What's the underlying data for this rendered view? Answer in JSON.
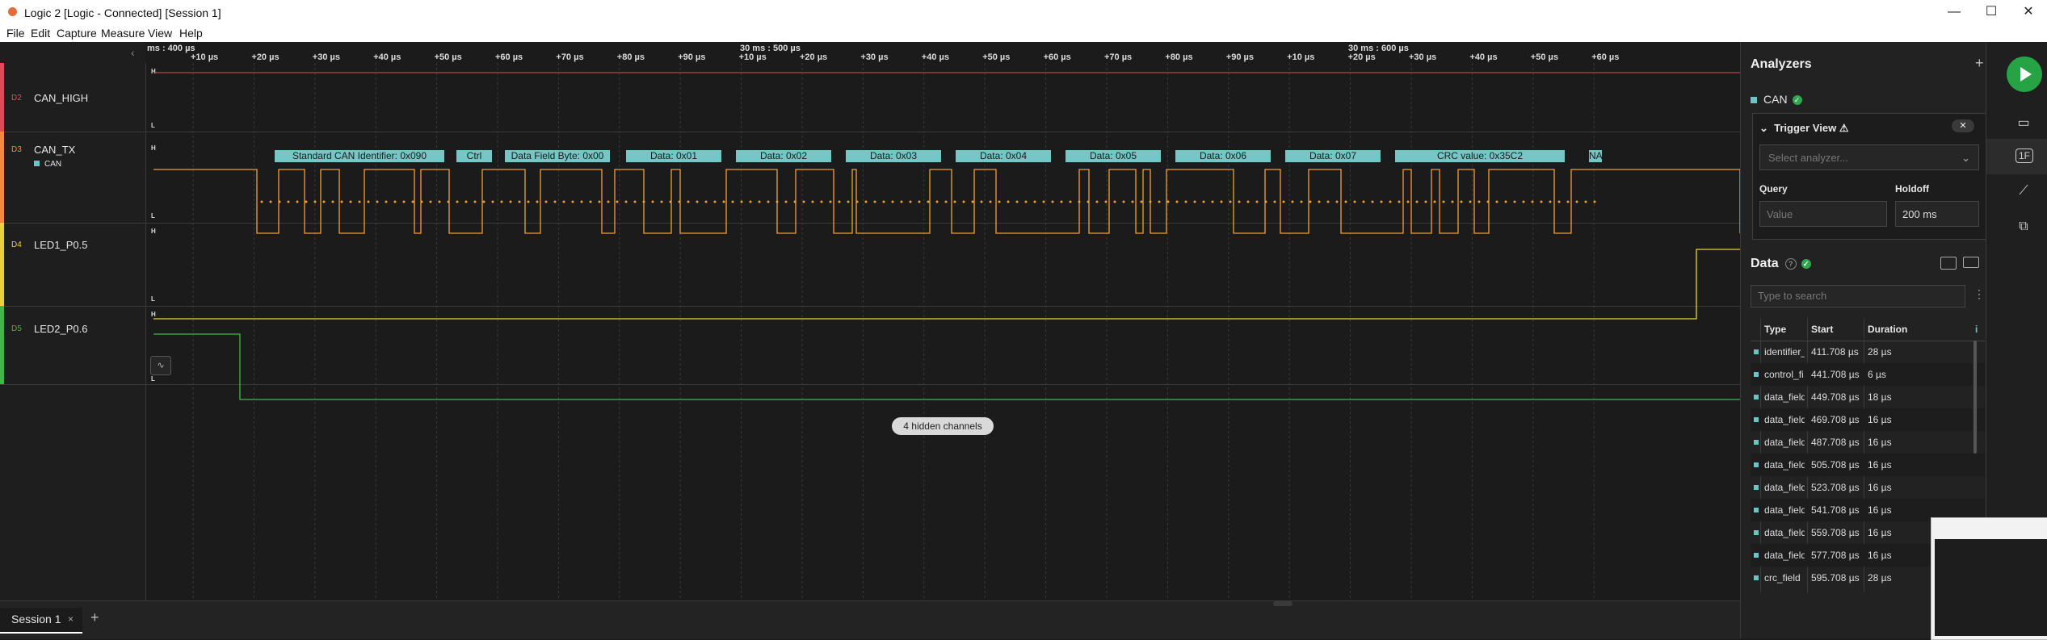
{
  "window": {
    "title": "Logic 2 [Logic - Connected] [Session 1]",
    "minimize": "—",
    "maximize": "☐",
    "close": "✕"
  },
  "menu": [
    "File",
    "Edit",
    "Capture",
    "Measure",
    "View",
    "Help"
  ],
  "ruler": {
    "start_label": "ms : 400 µs",
    "ticks": [
      "+10 µs",
      "+20 µs",
      "+30 µs",
      "+40 µs",
      "+50 µs",
      "+60 µs",
      "+70 µs",
      "+80 µs",
      "+90 µs",
      "+10 µs",
      "+20 µs",
      "+30 µs",
      "+40 µs",
      "+50 µs",
      "+60 µs",
      "+70 µs",
      "+80 µs",
      "+90 µs",
      "+10 µs",
      "+20 µs",
      "+30 µs",
      "+40 µs",
      "+50 µs",
      "+60 µs"
    ],
    "majors": [
      "30 ms : 500 µs",
      "30 ms : 600 µs"
    ]
  },
  "channels": [
    {
      "num": "D2",
      "name": "CAN_HIGH",
      "color": "#e24a5b",
      "high": "H",
      "low": "L"
    },
    {
      "num": "D3",
      "name": "CAN_TX",
      "sub": "CAN",
      "color": "#f08a3c",
      "high": "H",
      "low": "L"
    },
    {
      "num": "D4",
      "name": "LED1_P0.5",
      "color": "#e8d43a",
      "high": "H",
      "low": "L"
    },
    {
      "num": "D5",
      "name": "LED2_P0.6",
      "color": "#43b54a",
      "high": "H",
      "low": "L"
    }
  ],
  "can_frames": [
    "Standard CAN Identifier: 0x090",
    "Ctrl",
    "Data Field Byte: 0x00",
    "Data: 0x01",
    "Data: 0x02",
    "Data: 0x03",
    "Data: 0x04",
    "Data: 0x05",
    "Data: 0x06",
    "Data: 0x07",
    "CRC value: 0x35C2",
    "NA"
  ],
  "hidden_channels": "4 hidden channels",
  "measure_icon": "∿",
  "tabs": {
    "session": "Session 1",
    "close": "×",
    "add": "+"
  },
  "analyzers": {
    "header": "Analyzers",
    "add": "+",
    "item": "CAN",
    "trigger_view": {
      "title": "Trigger View",
      "warning": "⚠",
      "close": "✕",
      "select_placeholder": "Select analyzer...",
      "query_label": "Query",
      "holdoff_label": "Holdoff",
      "query_placeholder": "Value",
      "holdoff_value": "200 ms"
    }
  },
  "data": {
    "header": "Data",
    "help": "?",
    "search_placeholder": "Type to search",
    "columns": [
      "Type",
      "Start",
      "Duration"
    ],
    "rows": [
      {
        "type": "identifier_...",
        "start": "411.708 µs",
        "duration": "28 µs"
      },
      {
        "type": "control_fi...",
        "start": "441.708 µs",
        "duration": "6 µs"
      },
      {
        "type": "data_field",
        "start": "449.708 µs",
        "duration": "18 µs"
      },
      {
        "type": "data_field",
        "start": "469.708 µs",
        "duration": "16 µs"
      },
      {
        "type": "data_field",
        "start": "487.708 µs",
        "duration": "16 µs"
      },
      {
        "type": "data_field",
        "start": "505.708 µs",
        "duration": "16 µs"
      },
      {
        "type": "data_field",
        "start": "523.708 µs",
        "duration": "16 µs"
      },
      {
        "type": "data_field",
        "start": "541.708 µs",
        "duration": "16 µs"
      },
      {
        "type": "data_field",
        "start": "559.708 µs",
        "duration": "16 µs"
      },
      {
        "type": "data_field",
        "start": "577.708 µs",
        "duration": "16 µs"
      },
      {
        "type": "crc_field",
        "start": "595.708 µs",
        "duration": "28 µs"
      }
    ]
  },
  "colors": {
    "accent": "#6cc5c5",
    "signal": "#f0a030",
    "led1": "#e8d43a",
    "led2": "#43b54a",
    "play": "#26a445"
  }
}
